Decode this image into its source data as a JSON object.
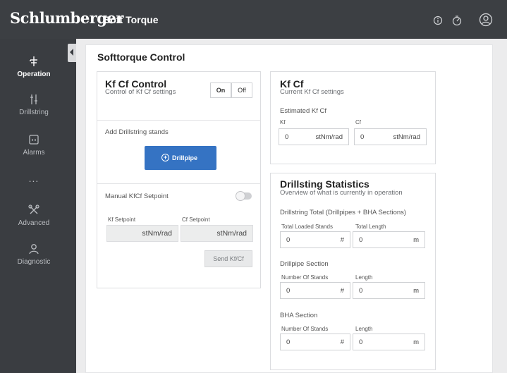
{
  "header": {
    "logo": "Schlumberger",
    "app_title": "Soft Torque",
    "icons": [
      "info-icon",
      "timer-icon",
      "user-icon"
    ]
  },
  "sidebar": {
    "items": [
      {
        "label": "Operation",
        "icon": "operation-icon",
        "active": true
      },
      {
        "label": "Drillstring",
        "icon": "drillstring-icon",
        "active": false
      },
      {
        "label": "Alarms",
        "icon": "alarms-icon",
        "active": false
      },
      {
        "label": "...",
        "icon": "more-icon",
        "active": false
      },
      {
        "label": "Advanced",
        "icon": "tools-icon",
        "active": false
      },
      {
        "label": "Diagnostic",
        "icon": "diagnostic-icon",
        "active": false
      }
    ]
  },
  "main": {
    "title": "Softtorque Control"
  },
  "kf_cf_control": {
    "title": "Kf Cf Control",
    "subtitle": "Control of Kf Cf settings",
    "on_label": "On",
    "off_label": "Off",
    "add_stands_label": "Add Drillstring stands",
    "drillpipe_button": "Drillpipe",
    "manual_setpoint_label": "Manual KfCf Setpoint",
    "kf_setpoint_label": "Kf Setpoint",
    "cf_setpoint_label": "Cf Setpoint",
    "kf_setpoint_unit": "stNm/rad",
    "cf_setpoint_unit": "stNm/rad",
    "send_button": "Send Kf/Cf"
  },
  "kf_cf": {
    "title": "Kf Cf",
    "subtitle": "Current Kf Cf settings",
    "estimated_label": "Estimated Kf Cf",
    "kf_label": "Kf",
    "cf_label": "Cf",
    "kf_value": "0",
    "kf_unit": "stNm/rad",
    "cf_value": "0",
    "cf_unit": "stNm/rad"
  },
  "stats": {
    "title": "Drillsting Statistics",
    "subtitle": "Overview of what is currently in operation",
    "total_section": "Drillstring Total (Drillpipes + BHA Sections)",
    "total_loaded_label": "Total Loaded Stands",
    "total_length_label": "Total Length",
    "total_loaded_value": "0",
    "total_loaded_unit": "#",
    "total_length_value": "0",
    "total_length_unit": "m",
    "drillpipe_section": "Drillpipe Section",
    "dp_stands_label": "Number Of Stands",
    "dp_length_label": "Length",
    "dp_stands_value": "0",
    "dp_stands_unit": "#",
    "dp_length_value": "0",
    "dp_length_unit": "m",
    "bha_section": "BHA Section",
    "bha_stands_label": "Number Of Stands",
    "bha_length_label": "Length",
    "bha_stands_value": "0",
    "bha_stands_unit": "#",
    "bha_length_value": "0",
    "bha_length_unit": "m"
  },
  "colors": {
    "topbar": "#3c3f43",
    "sidebar": "#3a3d41",
    "primary": "#3573c3",
    "background": "#ececed"
  }
}
